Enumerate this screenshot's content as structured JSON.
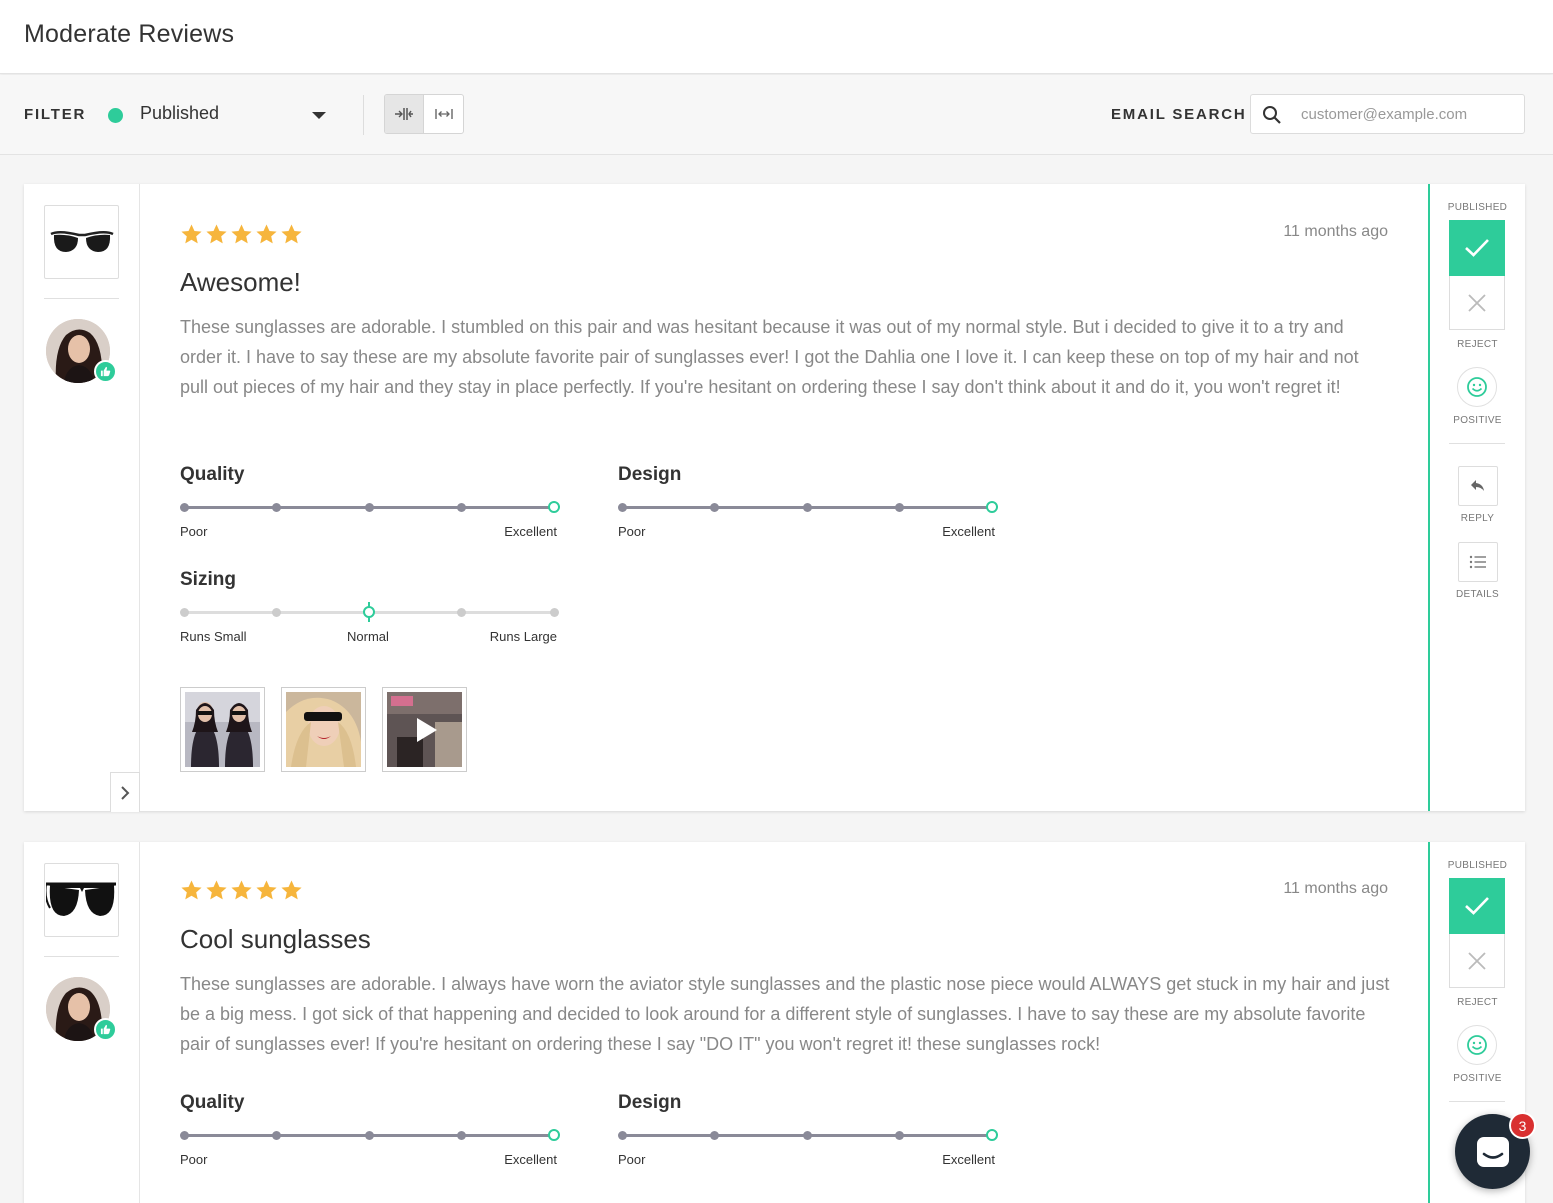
{
  "page": {
    "title": "Moderate Reviews"
  },
  "filter": {
    "label": "FILTER",
    "status_value": "Published",
    "status_color": "#2ecc9a",
    "email_label": "EMAIL SEARCH",
    "email_placeholder": "customer@example.com",
    "email_value": ""
  },
  "view_toggle": {
    "active": "compact"
  },
  "reviews": [
    {
      "stars": 5,
      "time": "11 months ago",
      "title": "Awesome!",
      "body": "These sunglasses are adorable. I stumbled on this pair and was hesitant because it was out of my normal style. But i decided to give it to a try and order it. I have to say these are my absolute favorite pair of sunglasses ever! I got the Dahlia one I love it. I can keep these on top of my hair and not pull out pieces of my hair and they stay in place perfectly. If you're hesitant on ordering these I say don't think about it and do it, you won't regret it!",
      "quality": {
        "label": "Quality",
        "value": 5,
        "min_label": "Poor",
        "max_label": "Excellent"
      },
      "design": {
        "label": "Design",
        "value": 5,
        "min_label": "Poor",
        "max_label": "Excellent"
      },
      "sizing": {
        "label": "Sizing",
        "value": 3,
        "min_label": "Runs Small",
        "mid_label": "Normal",
        "max_label": "Runs Large"
      },
      "status_label": "PUBLISHED",
      "reject_label": "REJECT",
      "sentiment_label": "POSITIVE",
      "reply_label": "REPLY",
      "details_label": "DETAILS"
    },
    {
      "stars": 5,
      "time": "11 months ago",
      "title": "Cool sunglasses",
      "body": "These sunglasses are adorable. I always have worn the aviator style sunglasses and the plastic nose piece would ALWAYS get stuck in my hair and just be a big mess. I got sick of that happening and decided to look around for a different style of sunglasses. I have to say these are my absolute favorite pair of sunglasses ever! If you're hesitant on ordering these I say \"DO IT\" you won't regret it! these sunglasses rock!",
      "quality": {
        "label": "Quality",
        "value": 5,
        "min_label": "Poor",
        "max_label": "Excellent"
      },
      "design": {
        "label": "Design",
        "value": 5,
        "min_label": "Poor",
        "max_label": "Excellent"
      },
      "status_label": "PUBLISHED",
      "reject_label": "REJECT",
      "sentiment_label": "POSITIVE"
    }
  ],
  "chat": {
    "unread": "3"
  },
  "colors": {
    "accent": "#2ecc9a",
    "star": "#f6b53c",
    "badge": "#d93030"
  }
}
